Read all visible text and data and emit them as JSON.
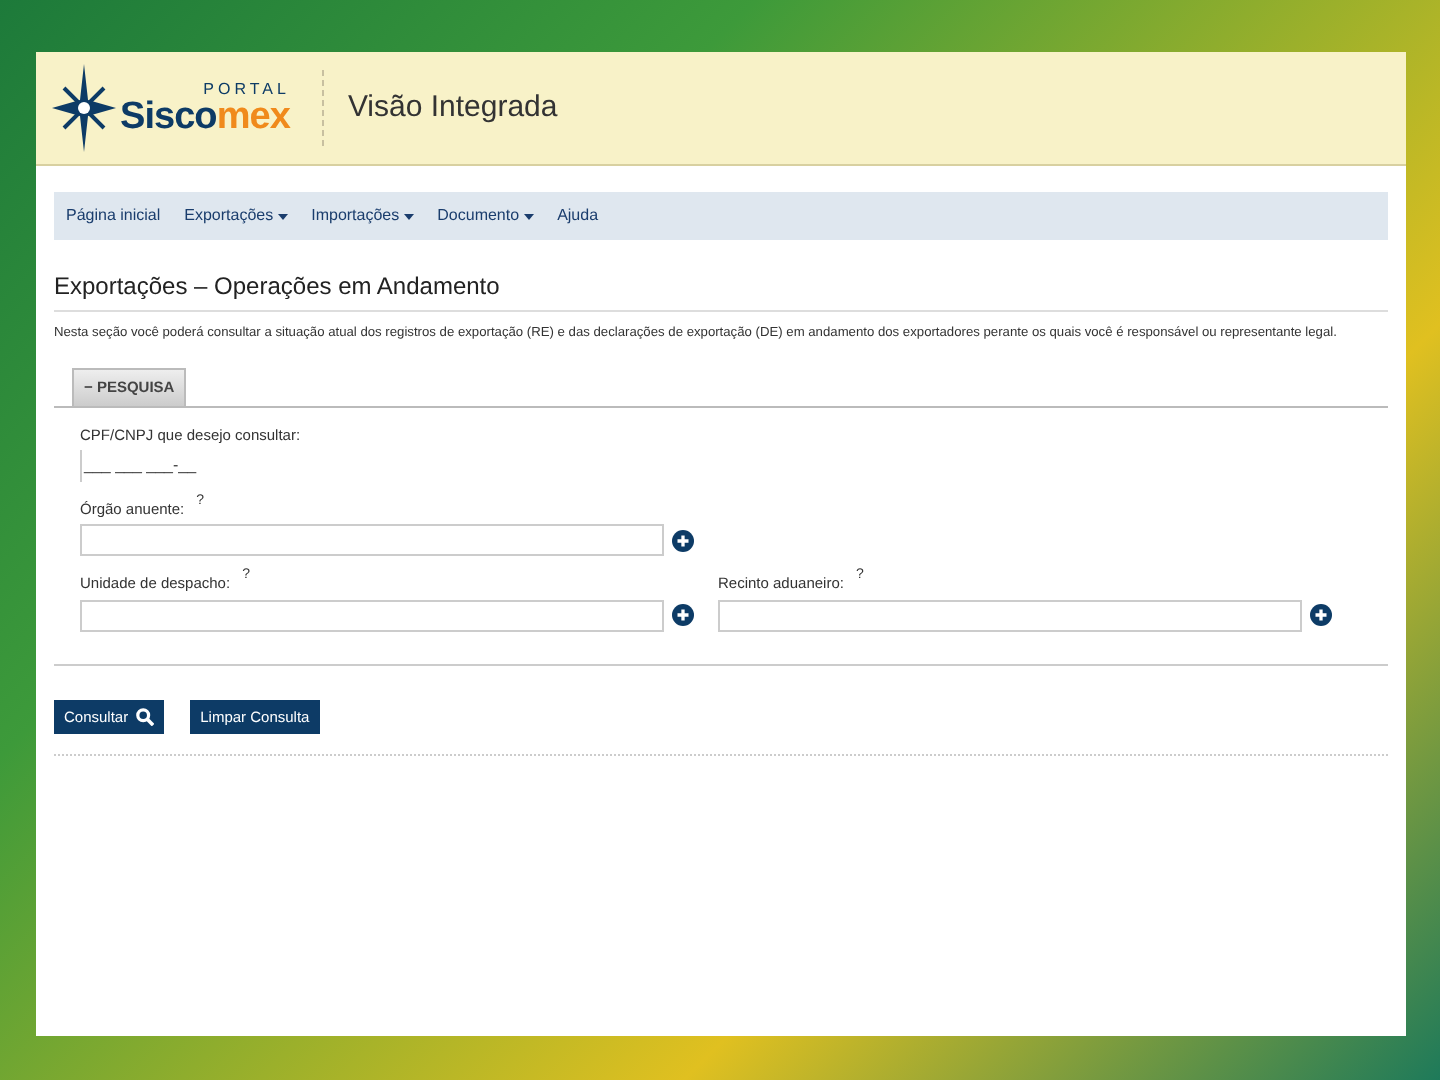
{
  "header": {
    "logo": {
      "small": "PORTAL",
      "main": "Sisco",
      "accent": "mex"
    },
    "title": "Visão Integrada"
  },
  "nav": [
    {
      "label": "Página inicial",
      "dropdown": false
    },
    {
      "label": "Exportações",
      "dropdown": true
    },
    {
      "label": "Importações",
      "dropdown": true
    },
    {
      "label": "Documento",
      "dropdown": true
    },
    {
      "label": "Ajuda",
      "dropdown": false
    }
  ],
  "heading": "Exportações – Operações em Andamento",
  "description": "Nesta seção você poderá consultar a situação atual dos registros de exportação (RE) e das declarações de exportação (DE) em andamento dos exportadores perante os quais você é responsável ou representante legal.",
  "search_section": {
    "toggle": "−",
    "title": "PESQUISA",
    "expanded": true
  },
  "fields": [
    {
      "kind": "mask",
      "label": "CPF/CNPJ que desejo consultar:",
      "value": "___ ___ ___-__"
    },
    {
      "kind": "lookup",
      "label": "Órgão anuente:",
      "help": "?"
    },
    {
      "kind": "lookup",
      "label": "Unidade de despacho:",
      "help": "?",
      "pair": {
        "label": "Recinto aduaneiro:",
        "help": "?"
      }
    }
  ],
  "buttons": [
    {
      "label": "Consultar",
      "icon": true
    },
    {
      "label": "Limpar Consulta",
      "icon": false
    }
  ]
}
